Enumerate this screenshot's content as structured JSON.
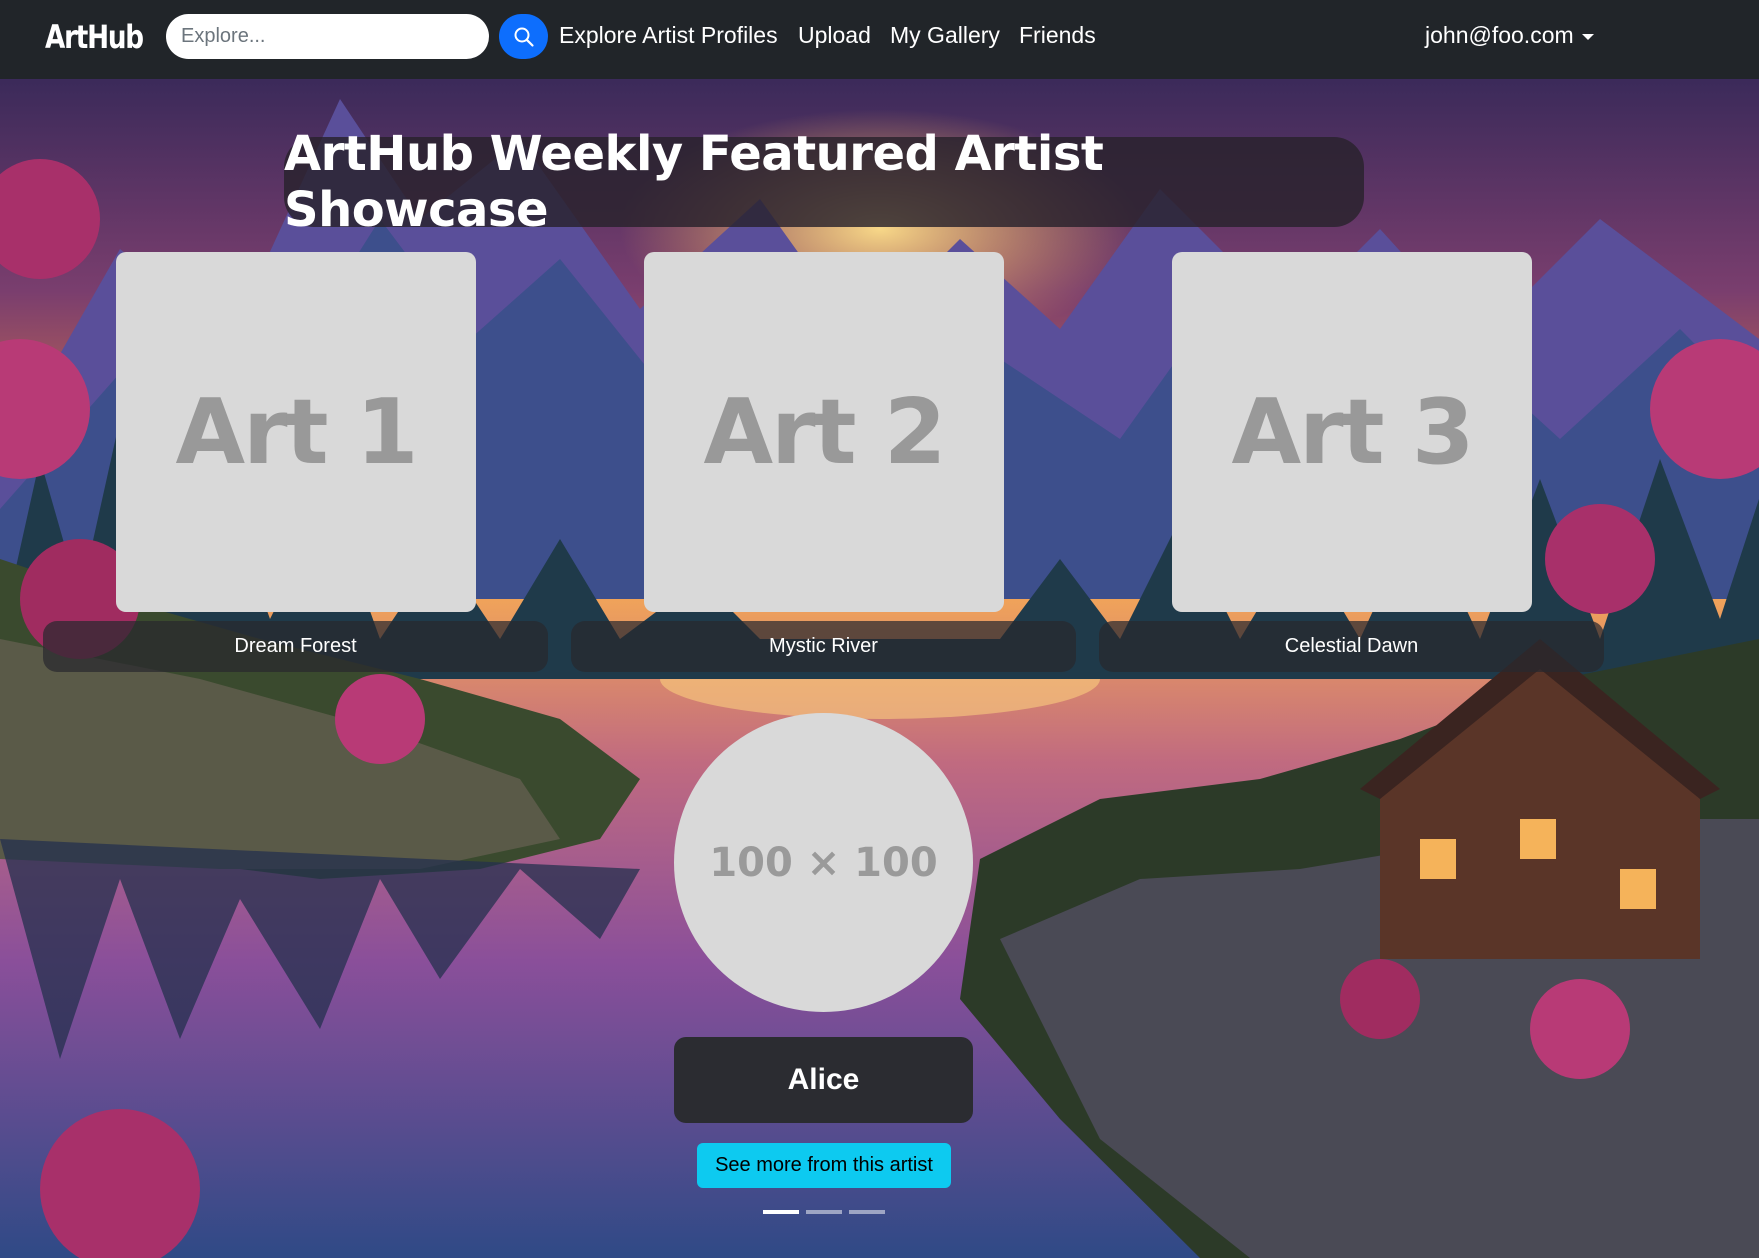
{
  "brand": "ArtHub",
  "search": {
    "placeholder": "Explore..."
  },
  "nav": {
    "links": [
      {
        "label": "Explore Artist Profiles"
      },
      {
        "label": "Upload"
      },
      {
        "label": "My Gallery"
      },
      {
        "label": "Friends"
      }
    ],
    "user_email": "john@foo.com"
  },
  "showcase": {
    "title": "ArtHub Weekly Featured Artist Showcase",
    "artworks": [
      {
        "placeholder": "Art 1",
        "title": "Dream Forest"
      },
      {
        "placeholder": "Art 2",
        "title": "Mystic River"
      },
      {
        "placeholder": "Art 3",
        "title": "Celestial Dawn"
      }
    ],
    "artist": {
      "avatar_placeholder": "100 × 100",
      "name": "Alice",
      "cta_label": "See more from this artist"
    },
    "carousel": {
      "slide_count": 3,
      "active_index": 0
    }
  },
  "colors": {
    "navbar": "#212529",
    "search_button": "#0d6efd",
    "cta_button": "#0dcaf0",
    "placeholder_tile": "#d9d9d9"
  },
  "icons": {
    "search_button": "search-icon",
    "user_menu": "caret-down-icon"
  }
}
